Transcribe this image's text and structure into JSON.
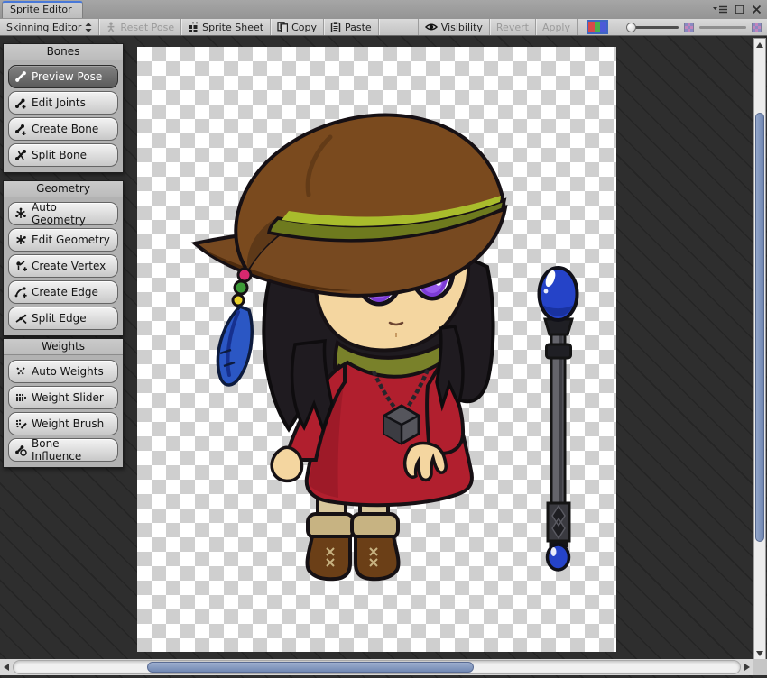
{
  "window": {
    "tab_title": "Sprite Editor",
    "controls": {
      "menu_icon": "menu-dropdown-icon",
      "maximize_icon": "maximize-icon",
      "close_icon": "close-icon"
    }
  },
  "toolbar": {
    "mode_dropdown": {
      "label": "Skinning Editor",
      "icon": "updown-arrows-icon"
    },
    "reset_pose": {
      "label": "Reset Pose",
      "disabled": true,
      "icon": "pose-figure-icon"
    },
    "sprite_sheet": {
      "label": "Sprite Sheet",
      "icon": "sprite-sheet-grid-icon"
    },
    "copy": {
      "label": "Copy",
      "icon": "copy-icon"
    },
    "paste": {
      "label": "Paste",
      "icon": "paste-icon"
    },
    "visibility": {
      "label": "Visibility",
      "icon": "eye-icon"
    },
    "revert": {
      "label": "Revert",
      "disabled": true
    },
    "apply": {
      "label": "Apply",
      "disabled": true
    },
    "rgb_toggle": {
      "icon": "rgb-channels-icon"
    },
    "zoom_slider": {
      "position": "min"
    },
    "mip_slider": {
      "left_icon": "mip-texture-icon",
      "right_icon": "mip-texture-icon"
    }
  },
  "sidebar": {
    "panels": [
      {
        "title": "Bones",
        "buttons": [
          {
            "label": "Preview Pose",
            "icon": "bone-icon",
            "active": true
          },
          {
            "label": "Edit Joints",
            "icon": "bone-joint-icon",
            "active": false
          },
          {
            "label": "Create Bone",
            "icon": "bone-add-icon",
            "active": false
          },
          {
            "label": "Split Bone",
            "icon": "bone-split-icon",
            "active": false
          }
        ]
      },
      {
        "title": "Geometry",
        "buttons": [
          {
            "label": "Auto Geometry",
            "icon": "geometry-auto-icon",
            "active": false
          },
          {
            "label": "Edit Geometry",
            "icon": "geometry-edit-icon",
            "active": false
          },
          {
            "label": "Create Vertex",
            "icon": "vertex-add-icon",
            "active": false
          },
          {
            "label": "Create Edge",
            "icon": "edge-add-icon",
            "active": false
          },
          {
            "label": "Split Edge",
            "icon": "edge-split-icon",
            "active": false
          }
        ]
      },
      {
        "title": "Weights",
        "buttons": [
          {
            "label": "Auto Weights",
            "icon": "weights-auto-icon",
            "active": false
          },
          {
            "label": "Weight Slider",
            "icon": "weight-slider-icon",
            "active": false
          },
          {
            "label": "Weight Brush",
            "icon": "weight-brush-icon",
            "active": false
          },
          {
            "label": "Bone Influence",
            "icon": "bone-influence-icon",
            "active": false
          }
        ]
      }
    ]
  },
  "canvas": {
    "background": "transparency-checker",
    "sprites": [
      {
        "name": "witch-character-sprite",
        "description": "chibi witch girl: brown floppy hat with olive band, blue feather charm with beads, black hair, large purple eyes, olive scarf, red dress with cube pendant necklace, tan leggings, brown boots"
      },
      {
        "name": "staff-sprite",
        "description": "gray magic staff with large blue orb on top and small blue orb at bottom"
      }
    ]
  },
  "colors": {
    "accent_blue": "#4878D8",
    "titlebar": "#9B9B9B",
    "toolbar": "#CDCDCD",
    "panel": "#B2B2B2",
    "canvas_dark": "#2E2E2E",
    "checker_light": "#FFFFFF",
    "checker_gray": "#CFCFCF",
    "scroll_thumb": "#7A8EB8",
    "hat_brown": "#7A4A1E",
    "band_olive": "#6E7A1E",
    "dress_red": "#B11F2E",
    "scarf_green": "#79812A",
    "skin": "#F4D6A0",
    "eye_purple": "#7C3BD6",
    "orb_blue": "#2543C8"
  }
}
